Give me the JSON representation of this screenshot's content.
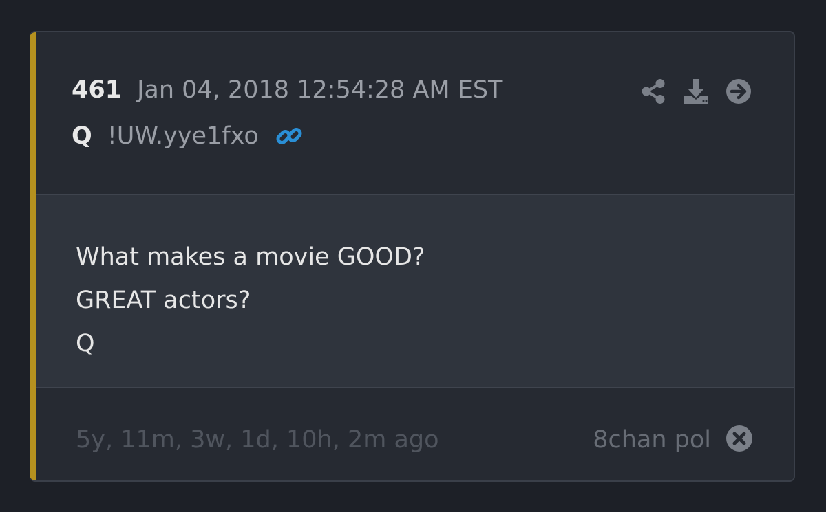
{
  "post": {
    "number": "461",
    "date": "Jan 04, 2018 12:54:28 AM EST",
    "author": "Q",
    "tripcode": "!UW.yye1fxo",
    "body_lines": [
      "What makes a movie GOOD?",
      "GREAT actors?",
      "Q"
    ],
    "age": "5y, 11m, 3w, 1d, 10h, 2m ago",
    "source": "8chan pol"
  },
  "icons": {
    "link": "link-icon",
    "share": "share-icon",
    "download": "download-icon",
    "navigate": "arrow-right-circle-icon",
    "close": "close-circle-icon"
  },
  "colors": {
    "accent": "#b5911f",
    "link": "#2a8fd6",
    "background": "#1d2027",
    "card": "#262a32",
    "body": "#2f343d"
  }
}
